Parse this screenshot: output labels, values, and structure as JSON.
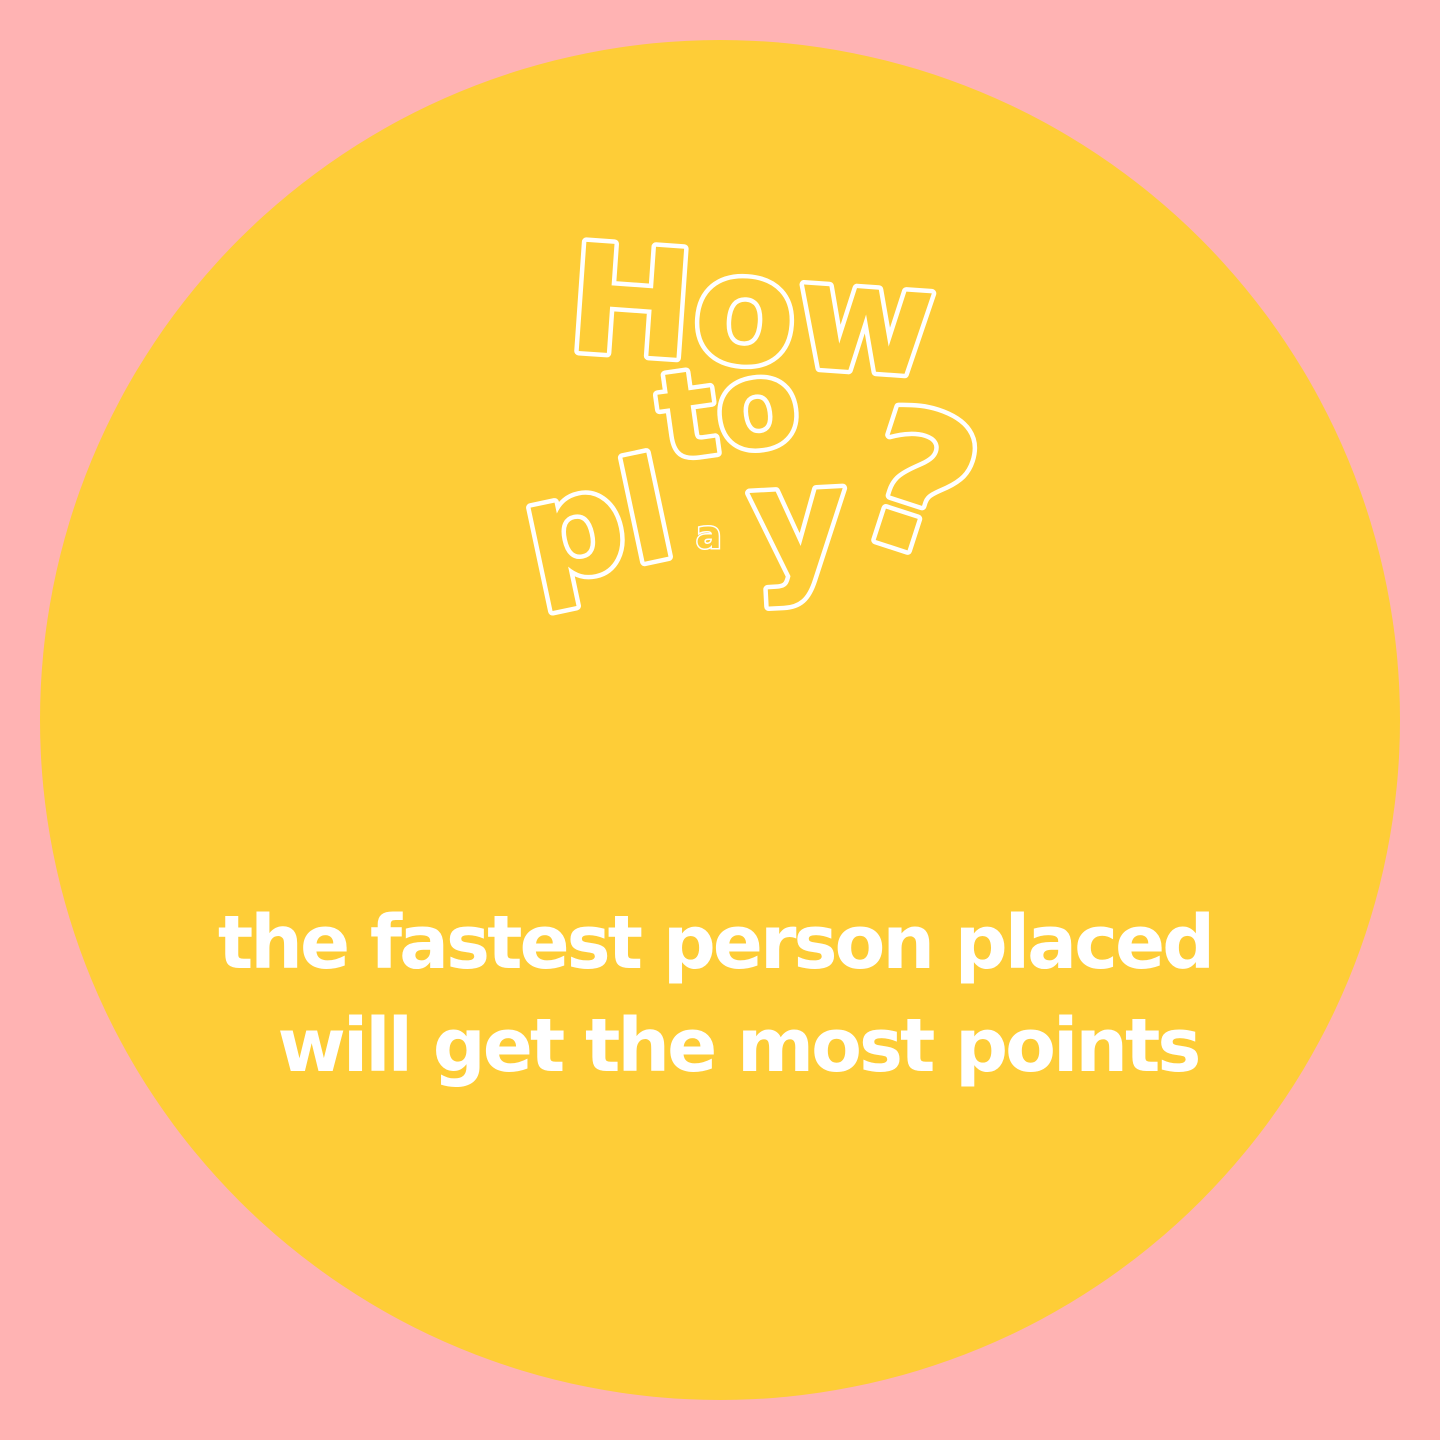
{
  "colors": {
    "background": "#FFB3B3",
    "circle": "#FECD37",
    "text": "#FFFFFF"
  },
  "title": {
    "how": "How",
    "to": "to",
    "pl": "pl",
    "a": "a",
    "y": "y",
    "question_mark": "?"
  },
  "instructions": {
    "line1": "the fastest person placed",
    "line2": "will get the most points"
  }
}
